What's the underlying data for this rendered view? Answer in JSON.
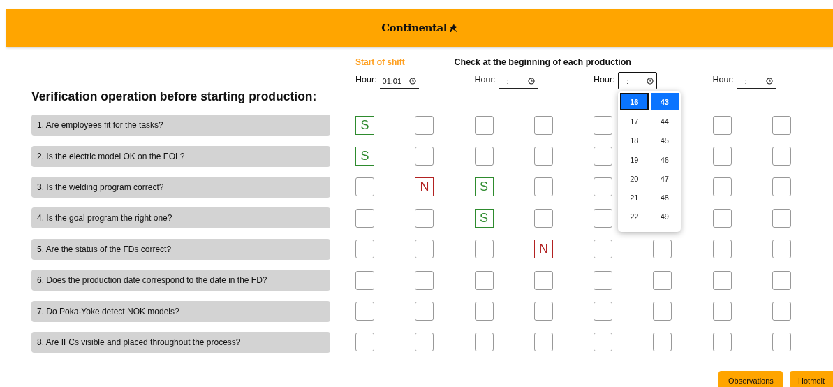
{
  "header": {
    "logo": "Continental"
  },
  "captions": {
    "start_of_shift": "Start of shift",
    "production_check": "Check at the beginning of each production"
  },
  "title": "Verification operation before starting production:",
  "time_fields": [
    {
      "label": "Hour:",
      "value": "01:01",
      "focused": false
    },
    {
      "label": "Hour:",
      "placeholder": "--:--",
      "focused": false
    },
    {
      "label": "Hour:",
      "placeholder": "--:--",
      "focused": true
    },
    {
      "label": "Hour:",
      "placeholder": "--:--",
      "focused": false
    }
  ],
  "time_picker": {
    "hours": [
      {
        "label": "16",
        "selected": true
      },
      {
        "label": "17",
        "selected": false
      },
      {
        "label": "18",
        "selected": false
      },
      {
        "label": "19",
        "selected": false
      },
      {
        "label": "20",
        "selected": false
      },
      {
        "label": "21",
        "selected": false
      },
      {
        "label": "22",
        "selected": false
      }
    ],
    "minutes": [
      {
        "label": "43",
        "selected": true
      },
      {
        "label": "44",
        "selected": false
      },
      {
        "label": "45",
        "selected": false
      },
      {
        "label": "46",
        "selected": false
      },
      {
        "label": "47",
        "selected": false
      },
      {
        "label": "48",
        "selected": false
      },
      {
        "label": "49",
        "selected": false
      }
    ]
  },
  "questions": [
    {
      "text": "1. Are employees fit for the tasks?",
      "answers": [
        {
          "kind": "yes",
          "text": "S"
        },
        {
          "kind": "empty"
        },
        {
          "kind": "empty"
        },
        {
          "kind": "empty"
        },
        {
          "kind": "empty"
        },
        {
          "kind": "covered"
        },
        {
          "kind": "empty"
        },
        {
          "kind": "empty"
        }
      ]
    },
    {
      "text": "2. Is the electric model OK on the EOL?",
      "answers": [
        {
          "kind": "yes",
          "text": "S"
        },
        {
          "kind": "empty"
        },
        {
          "kind": "empty"
        },
        {
          "kind": "empty"
        },
        {
          "kind": "empty"
        },
        {
          "kind": "covered"
        },
        {
          "kind": "empty"
        },
        {
          "kind": "empty"
        }
      ]
    },
    {
      "text": "3. Is the welding program correct?",
      "answers": [
        {
          "kind": "empty"
        },
        {
          "kind": "no",
          "text": "N"
        },
        {
          "kind": "yes",
          "text": "S"
        },
        {
          "kind": "empty"
        },
        {
          "kind": "empty"
        },
        {
          "kind": "covered"
        },
        {
          "kind": "empty"
        },
        {
          "kind": "empty"
        }
      ]
    },
    {
      "text": "4. Is the goal program the right one?",
      "answers": [
        {
          "kind": "empty"
        },
        {
          "kind": "empty"
        },
        {
          "kind": "yes",
          "text": "S"
        },
        {
          "kind": "empty"
        },
        {
          "kind": "empty"
        },
        {
          "kind": "covered"
        },
        {
          "kind": "empty"
        },
        {
          "kind": "empty"
        }
      ]
    },
    {
      "text": "5. Are the status of the FDs correct?",
      "answers": [
        {
          "kind": "empty"
        },
        {
          "kind": "empty"
        },
        {
          "kind": "empty"
        },
        {
          "kind": "no",
          "text": "N"
        },
        {
          "kind": "empty"
        },
        {
          "kind": "empty"
        },
        {
          "kind": "empty"
        },
        {
          "kind": "empty"
        }
      ]
    },
    {
      "text": "6. Does the production date correspond to the date in the FD?",
      "answers": [
        {
          "kind": "empty"
        },
        {
          "kind": "empty"
        },
        {
          "kind": "empty"
        },
        {
          "kind": "empty"
        },
        {
          "kind": "empty"
        },
        {
          "kind": "empty"
        },
        {
          "kind": "empty"
        },
        {
          "kind": "empty"
        }
      ]
    },
    {
      "text": "7. Do Poka-Yoke detect NOK models?",
      "answers": [
        {
          "kind": "empty"
        },
        {
          "kind": "empty"
        },
        {
          "kind": "empty"
        },
        {
          "kind": "empty"
        },
        {
          "kind": "empty"
        },
        {
          "kind": "empty"
        },
        {
          "kind": "empty"
        },
        {
          "kind": "empty"
        }
      ]
    },
    {
      "text": "8. Are IFCs visible and placed throughout the process?",
      "answers": [
        {
          "kind": "empty"
        },
        {
          "kind": "empty"
        },
        {
          "kind": "empty"
        },
        {
          "kind": "empty"
        },
        {
          "kind": "empty"
        },
        {
          "kind": "empty"
        },
        {
          "kind": "empty"
        },
        {
          "kind": "empty"
        }
      ]
    }
  ],
  "buttons": [
    "Observations",
    "Hotmelt"
  ]
}
